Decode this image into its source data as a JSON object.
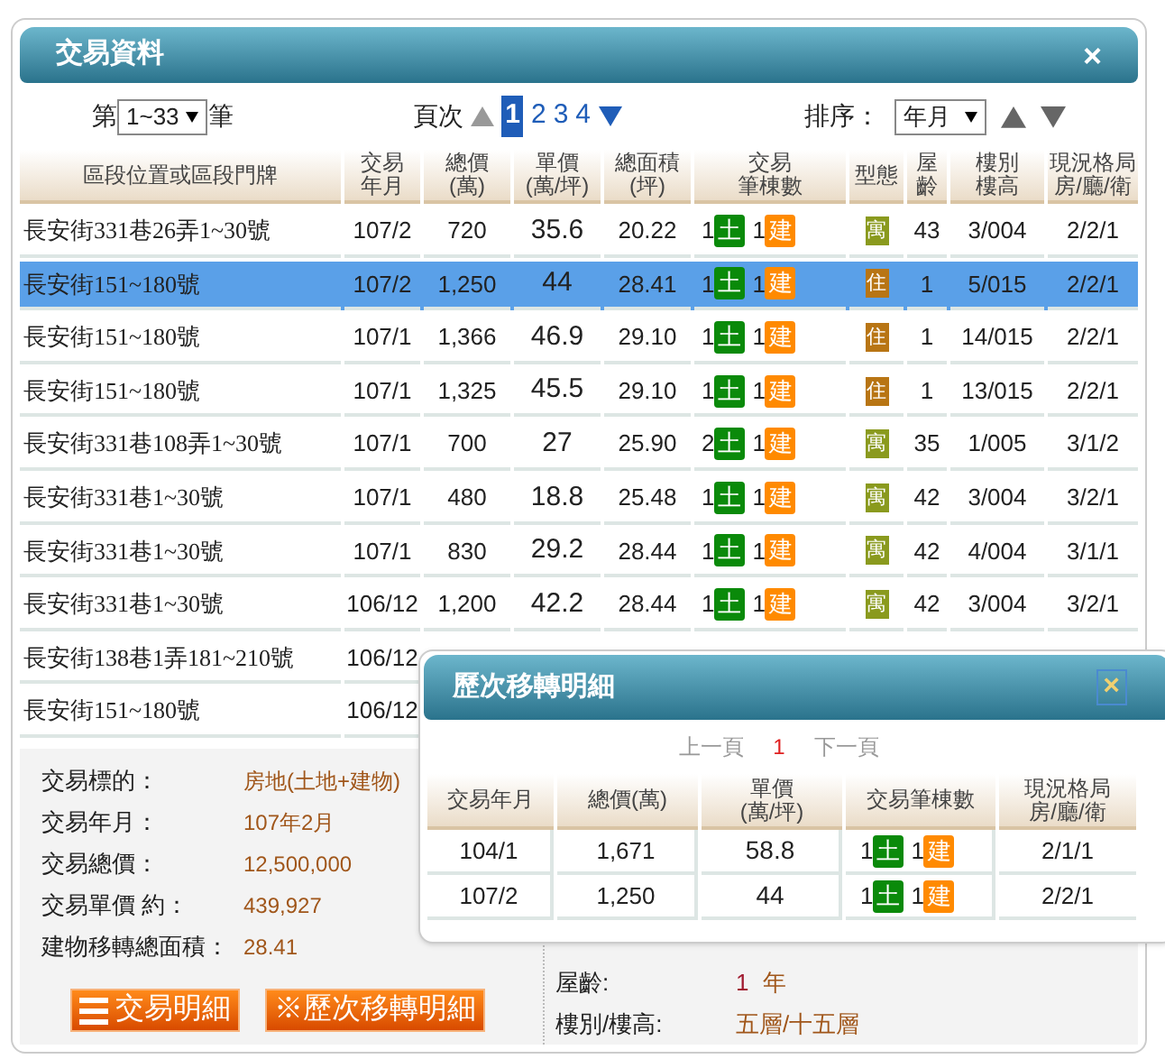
{
  "dialog": {
    "title": "交易資料",
    "close": "×"
  },
  "range": {
    "prefix": "第",
    "value": "1~33",
    "suffix": "筆"
  },
  "pager": {
    "label": "頁次",
    "pages": [
      {
        "label": "1",
        "selected": true
      },
      {
        "label": "2",
        "selected": false
      },
      {
        "label": "3",
        "selected": false
      },
      {
        "label": "4",
        "selected": false
      }
    ]
  },
  "sort": {
    "label": "排序：",
    "value": "年月"
  },
  "table": {
    "columns": [
      [
        "區段位置或區段門牌"
      ],
      [
        "交易",
        "年月"
      ],
      [
        "總價",
        "(萬)"
      ],
      [
        "單價",
        "(萬/坪)"
      ],
      [
        "總面積",
        "(坪)"
      ],
      [
        "交易",
        "筆棟數"
      ],
      [
        "型態"
      ],
      [
        "屋",
        "齡"
      ],
      [
        "樓別",
        "樓高"
      ],
      [
        "現況格局",
        "房/廳/衛"
      ]
    ],
    "rows": [
      {
        "selected": false,
        "address": "長安街331巷26弄1~30號",
        "date": "107/2",
        "total": "720",
        "unit": "35.6",
        "area": "20.22",
        "land": "1",
        "land_badge": "土",
        "building": "1",
        "building_badge": "建",
        "type": "寓",
        "color": "#8a9a1e",
        "age": "43",
        "floor": "3/004",
        "layout": "2/2/1"
      },
      {
        "selected": true,
        "address": "長安街151~180號",
        "date": "107/2",
        "total": "1,250",
        "unit": "44",
        "area": "28.41",
        "land": "1",
        "land_badge": "土",
        "building": "1",
        "building_badge": "建",
        "type": "住",
        "color": "#b87514",
        "age": "1",
        "floor": "5/015",
        "layout": "2/2/1"
      },
      {
        "selected": false,
        "address": "長安街151~180號",
        "date": "107/1",
        "total": "1,366",
        "unit": "46.9",
        "area": "29.10",
        "land": "1",
        "land_badge": "土",
        "building": "1",
        "building_badge": "建",
        "type": "住",
        "color": "#b87514",
        "age": "1",
        "floor": "14/015",
        "layout": "2/2/1"
      },
      {
        "selected": false,
        "address": "長安街151~180號",
        "date": "107/1",
        "total": "1,325",
        "unit": "45.5",
        "area": "29.10",
        "land": "1",
        "land_badge": "土",
        "building": "1",
        "building_badge": "建",
        "type": "住",
        "color": "#b87514",
        "age": "1",
        "floor": "13/015",
        "layout": "2/2/1"
      },
      {
        "selected": false,
        "address": "長安街331巷108弄1~30號",
        "date": "107/1",
        "total": "700",
        "unit": "27",
        "area": "25.90",
        "land": "2",
        "land_badge": "土",
        "building": "1",
        "building_badge": "建",
        "type": "寓",
        "color": "#8a9a1e",
        "age": "35",
        "floor": "1/005",
        "layout": "3/1/2"
      },
      {
        "selected": false,
        "address": "長安街331巷1~30號",
        "date": "107/1",
        "total": "480",
        "unit": "18.8",
        "area": "25.48",
        "land": "1",
        "land_badge": "土",
        "building": "1",
        "building_badge": "建",
        "type": "寓",
        "color": "#8a9a1e",
        "age": "42",
        "floor": "3/004",
        "layout": "3/2/1"
      },
      {
        "selected": false,
        "address": "長安街331巷1~30號",
        "date": "107/1",
        "total": "830",
        "unit": "29.2",
        "area": "28.44",
        "land": "1",
        "land_badge": "土",
        "building": "1",
        "building_badge": "建",
        "type": "寓",
        "color": "#8a9a1e",
        "age": "42",
        "floor": "4/004",
        "layout": "3/1/1"
      },
      {
        "selected": false,
        "address": "長安街331巷1~30號",
        "date": "106/12",
        "total": "1,200",
        "unit": "42.2",
        "area": "28.44",
        "land": "1",
        "land_badge": "土",
        "building": "1",
        "building_badge": "建",
        "type": "寓",
        "color": "#8a9a1e",
        "age": "42",
        "floor": "3/004",
        "layout": "3/2/1"
      },
      {
        "selected": false,
        "address": "長安街138巷1弄181~210號",
        "date": "106/12"
      },
      {
        "selected": false,
        "address": "長安街151~180號",
        "date": "106/12"
      }
    ]
  },
  "details": {
    "left": [
      {
        "label": "交易標的：",
        "value": "房地(土地+建物)"
      },
      {
        "label": "交易年月：",
        "value": "107年2月"
      },
      {
        "label": "交易總價：",
        "value": "12,500,000"
      },
      {
        "label": "交易單價 約：",
        "value": "439,927"
      },
      {
        "label": "建物移轉總面積：",
        "value": "28.41"
      }
    ],
    "right": [
      {
        "label": "屋齡:",
        "value": "1",
        "unit": "年"
      },
      {
        "label": "樓別/樓高:",
        "value": "五層/十五層"
      }
    ],
    "buttons": [
      {
        "kind": "list",
        "label": "交易明細"
      },
      {
        "kind": "plain",
        "label": "※歷次移轉明細"
      }
    ]
  },
  "history": {
    "title": "歷次移轉明細",
    "close": "×",
    "prev": "上一頁",
    "page": "1",
    "next": "下一頁",
    "columns": [
      [
        "交易年月"
      ],
      [
        "總價(萬)"
      ],
      [
        "單價",
        "(萬/坪)"
      ],
      [
        "交易筆棟數"
      ],
      [
        "現況格局",
        "房/廳/衛"
      ]
    ],
    "rows": [
      {
        "date": "104/1",
        "total": "1,671",
        "unit": "58.8",
        "land": "1",
        "land_badge": "土",
        "building": "1",
        "building_badge": "建",
        "layout": "2/1/1"
      },
      {
        "date": "107/2",
        "total": "1,250",
        "unit": "44",
        "land": "1",
        "land_badge": "土",
        "building": "1",
        "building_badge": "建",
        "layout": "2/2/1"
      }
    ]
  }
}
